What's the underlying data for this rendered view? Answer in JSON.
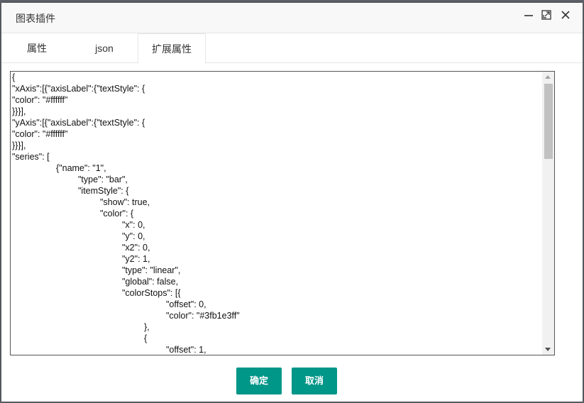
{
  "dialog": {
    "title": "图表插件"
  },
  "window_controls": [
    {
      "icon": "minimize-icon"
    },
    {
      "icon": "maximize-icon"
    },
    {
      "icon": "close-icon"
    }
  ],
  "tabs": [
    {
      "label": "属性",
      "active": false
    },
    {
      "label": "json",
      "active": false
    },
    {
      "label": "扩展属性",
      "active": true
    }
  ],
  "editor": {
    "content": "{\n\"xAxis\":[{\"axisLabel\":{\"textStyle\": {\n\"color\": \"#ffffff\"\n}}}],\n\"yAxis\":[{\"axisLabel\":{\"textStyle\": {\n\"color\": \"#ffffff\"\n}}}],\n\"series\": [\n\t\t{\"name\": \"1\",\n\t\t\t\"type\": \"bar\",\n\t\t\t\"itemStyle\": {\n\t\t\t\t\"show\": true,\n\t\t\t\t\"color\": {\n\t\t\t\t\t\"x\": 0,\n\t\t\t\t\t\"y\": 0,\n\t\t\t\t\t\"x2\": 0,\n\t\t\t\t\t\"y2\": 1,\n\t\t\t\t\t\"type\": \"linear\",\n\t\t\t\t\t\"global\": false,\n\t\t\t\t\t\"colorStops\": [{\n\t\t\t\t\t\t\t\"offset\": 0,\n\t\t\t\t\t\t\t\"color\": \"#3fb1e3ff\"\n\t\t\t\t\t\t},\n\t\t\t\t\t\t{\n\t\t\t\t\t\t\t\"offset\": 1,"
  },
  "buttons": {
    "confirm": "确定",
    "cancel": "取消"
  },
  "colors": {
    "accent": "#009688",
    "titlebar_bg": "#f8f8f8"
  }
}
